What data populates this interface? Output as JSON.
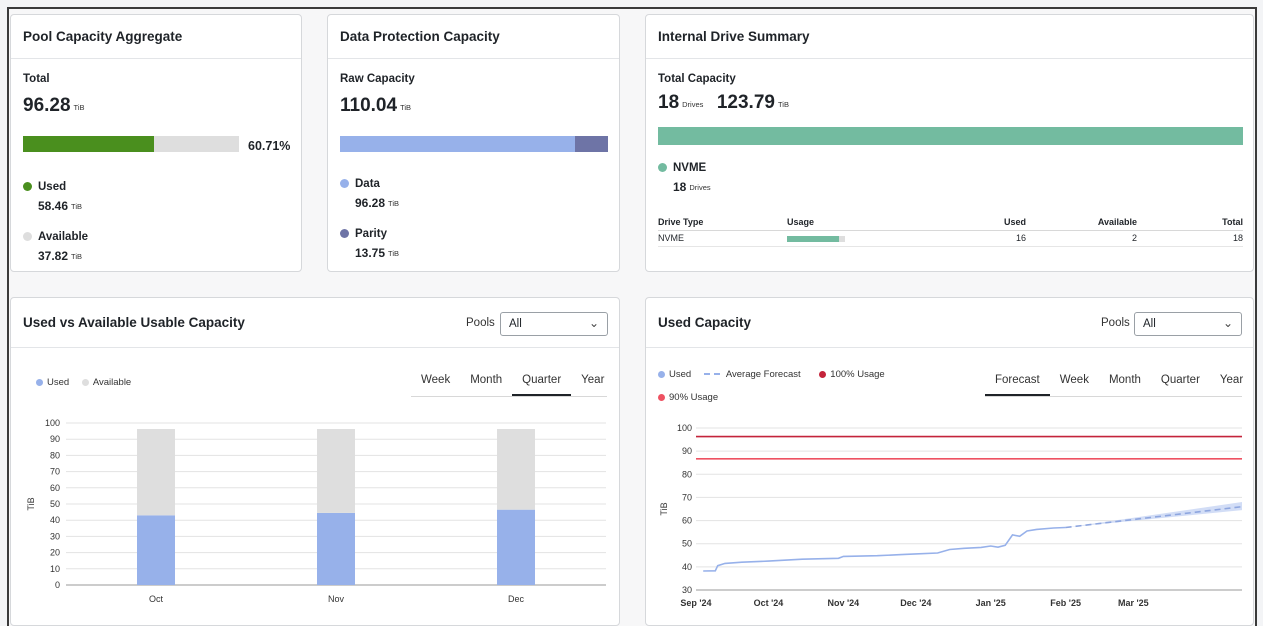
{
  "pool": {
    "title": "Pool Capacity Aggregate",
    "total_label": "Total",
    "total_value": "96.28",
    "unit": "TiB",
    "used_fraction": 0.6071,
    "percent_text": "60.71%",
    "used_label": "Used",
    "used_value": "58.46",
    "available_label": "Available",
    "available_value": "37.82",
    "colors": {
      "used": "#4a8f1e",
      "available": "#dedede"
    }
  },
  "protection": {
    "title": "Data Protection Capacity",
    "raw_label": "Raw Capacity",
    "raw_value": "110.04",
    "unit": "TiB",
    "data_fraction": 0.875,
    "data_label": "Data",
    "data_value": "96.28",
    "parity_label": "Parity",
    "parity_value": "13.75",
    "colors": {
      "data": "#97b1ea",
      "parity": "#6e74a6"
    }
  },
  "drives": {
    "title": "Internal Drive Summary",
    "total_label": "Total Capacity",
    "count": "18",
    "drives_unit": "Drives",
    "capacity": "123.79",
    "unit": "TiB",
    "type_label": "NVME",
    "type_count": "18",
    "color": "#73bba0",
    "table": {
      "headers": [
        "Drive Type",
        "Usage",
        "Used",
        "Available",
        "Total"
      ],
      "rows": [
        {
          "type": "NVME",
          "usage_fraction": 0.89,
          "used": "16",
          "available": "2",
          "total": "18"
        }
      ]
    }
  },
  "usable": {
    "title": "Used vs Available Usable Capacity",
    "pools_label": "Pools",
    "pools_value": "All",
    "legend_used": "Used",
    "legend_available": "Available",
    "tabs": [
      "Week",
      "Month",
      "Quarter",
      "Year"
    ],
    "active_tab": "Quarter"
  },
  "used_capacity": {
    "title": "Used Capacity",
    "pools_label": "Pools",
    "pools_value": "All",
    "legend_used": "Used",
    "legend_forecast": "Average Forecast",
    "legend_100": "100% Usage",
    "legend_90": "90% Usage",
    "tabs": [
      "Forecast",
      "Week",
      "Month",
      "Quarter",
      "Year"
    ],
    "active_tab": "Forecast"
  },
  "chart_data": [
    {
      "type": "bar",
      "stacked": true,
      "categories": [
        "Oct",
        "Nov",
        "Dec"
      ],
      "series": [
        {
          "name": "Used",
          "values": [
            43,
            44.5,
            46.5
          ],
          "color": "#97b1ea"
        },
        {
          "name": "Available",
          "values": [
            53.28,
            51.78,
            49.78
          ],
          "color": "#dedede"
        }
      ],
      "ylabel": "TiB",
      "ylim": [
        0,
        100
      ],
      "yticks": [
        0,
        10,
        20,
        30,
        40,
        50,
        60,
        70,
        80,
        90,
        100
      ],
      "grid": true,
      "legend": "top-left"
    },
    {
      "type": "line",
      "ylabel": "TiB",
      "ylim": [
        30,
        100
      ],
      "yticks": [
        30,
        40,
        50,
        60,
        70,
        80,
        90,
        100
      ],
      "xlim": [
        "2024-09-01",
        "2025-04-15"
      ],
      "xticks": [
        {
          "date": "2024-09-01",
          "label": "Sep '24"
        },
        {
          "date": "2024-10-01",
          "label": "Oct '24"
        },
        {
          "date": "2024-11-01",
          "label": "Nov '24"
        },
        {
          "date": "2024-12-01",
          "label": "Dec '24"
        },
        {
          "date": "2025-01-01",
          "label": "Jan '25"
        },
        {
          "date": "2025-02-01",
          "label": "Feb '25"
        },
        {
          "date": "2025-03-01",
          "label": "Mar '25"
        }
      ],
      "series": [
        {
          "name": "Used",
          "color": "#97b1ea",
          "points": [
            [
              "2024-09-04",
              38.2
            ],
            [
              "2024-09-09",
              38.3
            ],
            [
              "2024-09-10",
              40.5
            ],
            [
              "2024-09-13",
              41.5
            ],
            [
              "2024-09-20",
              42
            ],
            [
              "2024-10-01",
              42.5
            ],
            [
              "2024-10-15",
              43.3
            ],
            [
              "2024-10-30",
              43.7
            ],
            [
              "2024-11-01",
              44.5
            ],
            [
              "2024-11-15",
              44.8
            ],
            [
              "2024-11-25",
              45.3
            ],
            [
              "2024-12-01",
              45.6
            ],
            [
              "2024-12-10",
              46
            ],
            [
              "2024-12-15",
              47.5
            ],
            [
              "2024-12-21",
              48
            ],
            [
              "2024-12-28",
              48.4
            ],
            [
              "2025-01-01",
              49
            ],
            [
              "2025-01-04",
              48.5
            ],
            [
              "2025-01-07",
              49.3
            ],
            [
              "2025-01-10",
              53.8
            ],
            [
              "2025-01-13",
              53.2
            ],
            [
              "2025-01-16",
              55.5
            ],
            [
              "2025-01-20",
              56.2
            ],
            [
              "2025-01-27",
              56.8
            ],
            [
              "2025-02-01",
              57
            ]
          ]
        },
        {
          "name": "Average Forecast",
          "color": "#97b1ea",
          "points": [
            [
              "2025-02-01",
              57
            ],
            [
              "2025-04-15",
              66
            ]
          ]
        },
        {
          "name": "100% Usage",
          "color": "#c4243b",
          "value": 96.3
        },
        {
          "name": "90% Usage",
          "color": "#ee5262",
          "value": 86.7
        }
      ],
      "grid": true,
      "legend": "top-left"
    }
  ]
}
